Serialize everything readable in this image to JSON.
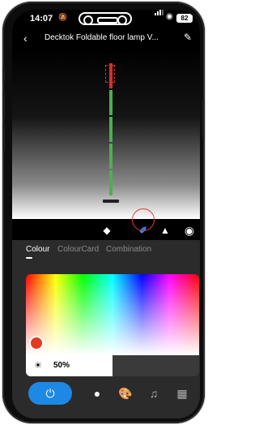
{
  "status_bar": {
    "time": "14:07",
    "battery": "82",
    "icons": [
      "bell-slash-icon",
      "signal-icon",
      "wifi-icon",
      "battery-icon"
    ]
  },
  "header": {
    "title": "Decktok Foldable floor lamp V...",
    "icons": [
      "back-icon",
      "edit-icon"
    ]
  },
  "toolbar": {
    "icons": [
      "paint-bucket-icon",
      "brush-icon",
      "eraser-icon",
      "color-indicator-icon"
    ],
    "selected": "brush-icon"
  },
  "tabs": [
    {
      "label": "Colour",
      "active": true
    },
    {
      "label": "ColourCard",
      "active": false
    },
    {
      "label": "Combination",
      "active": false
    }
  ],
  "colour_picker": {
    "selected_color": "#e53a1e"
  },
  "brightness": {
    "label": "50%",
    "value": 0.5
  },
  "bottom_nav": {
    "items": [
      "power-icon",
      "bulb-icon",
      "palette-icon",
      "music-icon",
      "scenes-icon"
    ],
    "accent": "#1e88e5"
  },
  "lamp": {
    "segment_colors": [
      "#d32f2f",
      "#4caf50",
      "#4caf50",
      "#4caf50",
      "#4caf50"
    ]
  }
}
